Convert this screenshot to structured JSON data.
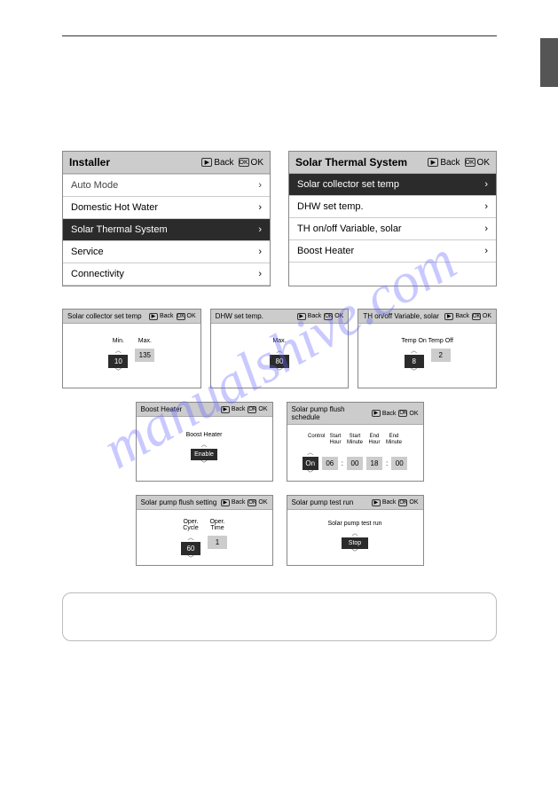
{
  "hdr": {
    "back": "Back",
    "ok": "OK"
  },
  "left_menu": {
    "title": "Installer",
    "items": [
      "Auto Mode",
      "Domestic Hot Water",
      "Solar Thermal System",
      "Service",
      "Connectivity"
    ],
    "selected": 2,
    "truncated_top": true
  },
  "right_menu": {
    "title": "Solar Thermal System",
    "items": [
      "Solar collector set temp",
      "DHW set temp.",
      "TH on/off Variable, solar",
      "Boost Heater"
    ],
    "selected": 0
  },
  "p_collector": {
    "title": "Solar collector set temp",
    "labels": {
      "min": "Min.",
      "max": "Max."
    },
    "min": "10",
    "max": "135"
  },
  "p_dhw": {
    "title": "DHW set temp.",
    "labels": {
      "max": "Max."
    },
    "max": "80"
  },
  "p_th": {
    "title": "TH on/off Variable, solar",
    "labels": {
      "on": "Temp On",
      "off": "Temp Off"
    },
    "on": "8",
    "off": "2"
  },
  "p_boost": {
    "title": "Boost Heater",
    "label": "Boost Heater",
    "value": "Enable"
  },
  "p_schedule": {
    "title": "Solar pump flush schedule",
    "labels": {
      "ctrl": "Control",
      "sh": "Start Hour",
      "sm": "Start Minute",
      "eh": "End Hour",
      "em": "End Minute"
    },
    "ctrl": "On",
    "sh": "06",
    "sm": "00",
    "eh": "18",
    "em": "00"
  },
  "p_flush": {
    "title": "Solar pump flush setting",
    "labels": {
      "cycle": "Oper. Cycle",
      "time": "Oper. Time"
    },
    "cycle": "60",
    "time": "1"
  },
  "p_test": {
    "title": "Solar pump test run",
    "label": "Solar pump test run",
    "value": "Stop"
  },
  "watermark": "manualshive.com"
}
